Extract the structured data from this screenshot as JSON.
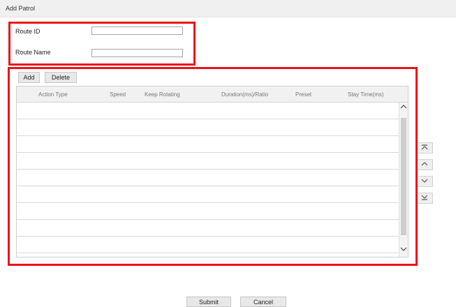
{
  "dialog": {
    "title": "Add Patrol"
  },
  "form": {
    "route_id_label": "Route ID",
    "route_id_value": "",
    "route_name_label": "Route Name",
    "route_name_value": ""
  },
  "toolbar": {
    "add_label": "Add",
    "delete_label": "Delete"
  },
  "table": {
    "columns": [
      "Action Type",
      "Speed",
      "Keep Rotating",
      "Duration(ms)/Ratio",
      "Preset",
      "Stay Time(ms)"
    ],
    "visible_row_count": 9
  },
  "order_buttons": {
    "icons": [
      "move-to-top-icon",
      "move-up-icon",
      "move-down-icon",
      "move-to-bottom-icon"
    ]
  },
  "footer": {
    "submit_label": "Submit",
    "cancel_label": "Cancel"
  },
  "colors": {
    "annotation": "#e8151b",
    "header_bg": "#f1f1f1",
    "button_bg": "#e8e8e8"
  }
}
